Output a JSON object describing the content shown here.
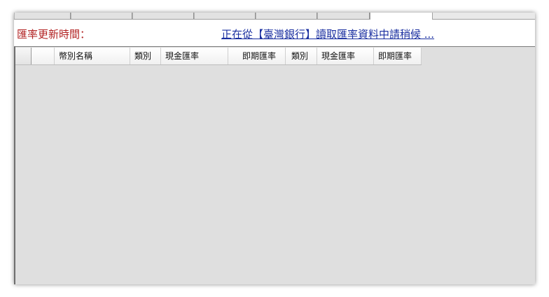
{
  "status": {
    "update_time_label": "匯率更新時間：",
    "loading_message": "正在從【臺灣銀行】讀取匯率資料中請稍候 ..."
  },
  "grid": {
    "columns": [
      "幣別名稱",
      "類別",
      "現金匯率",
      "即期匯率",
      "類別",
      "現金匯率",
      "即期匯率"
    ]
  }
}
